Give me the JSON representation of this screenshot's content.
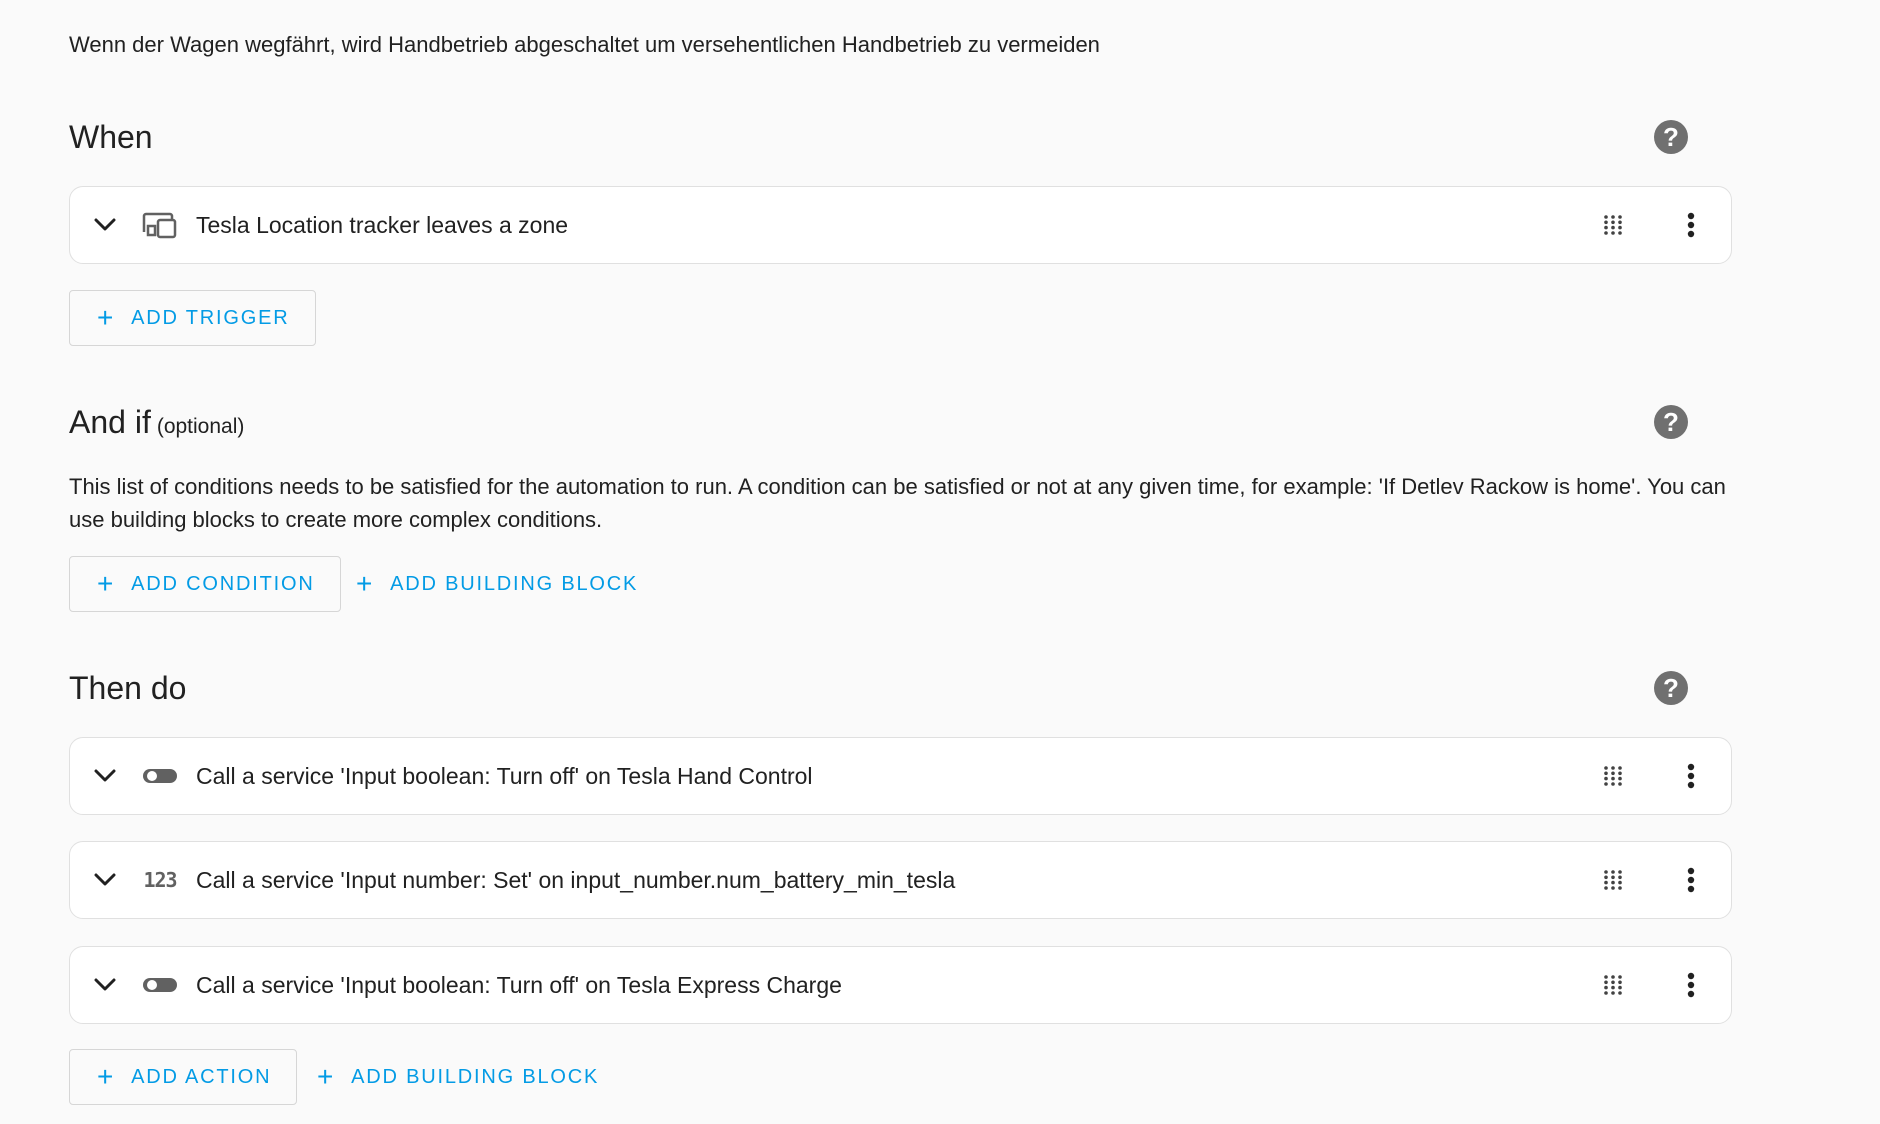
{
  "description": "Wenn der Wagen wegfährt, wird Handbetrieb abgeschaltet um versehentlichen Handbetrieb zu vermeiden",
  "when": {
    "title": "When",
    "help_icon": "help-circle-icon",
    "triggers": [
      {
        "icon": "devices-icon",
        "label": "Tesla Location tracker leaves a zone"
      }
    ],
    "add_trigger_label": "ADD TRIGGER"
  },
  "and_if": {
    "title": "And if",
    "optional_label": "(optional)",
    "help_icon": "help-circle-icon",
    "description": "This list of conditions needs to be satisfied for the automation to run. A condition can be satisfied or not at any given time, for example: 'If Detlev Rackow is home'. You can use building blocks to create more complex conditions.",
    "add_condition_label": "ADD CONDITION",
    "add_building_block_label": "ADD BUILDING BLOCK"
  },
  "then_do": {
    "title": "Then do",
    "help_icon": "help-circle-icon",
    "actions": [
      {
        "icon": "toggle-switch-off-icon",
        "label": "Call a service 'Input boolean: Turn off' on Tesla Hand Control"
      },
      {
        "icon": "numeric-icon",
        "icon_text": "123",
        "label": "Call a service 'Input number: Set' on input_number.num_battery_min_tesla"
      },
      {
        "icon": "toggle-switch-off-icon",
        "label": "Call a service 'Input boolean: Turn off' on Tesla Express Charge"
      }
    ],
    "add_action_label": "ADD ACTION",
    "add_building_block_label": "ADD BUILDING BLOCK"
  },
  "colors": {
    "accent": "#039be5",
    "background": "#fafafa",
    "card": "#ffffff",
    "icon": "#616161"
  }
}
